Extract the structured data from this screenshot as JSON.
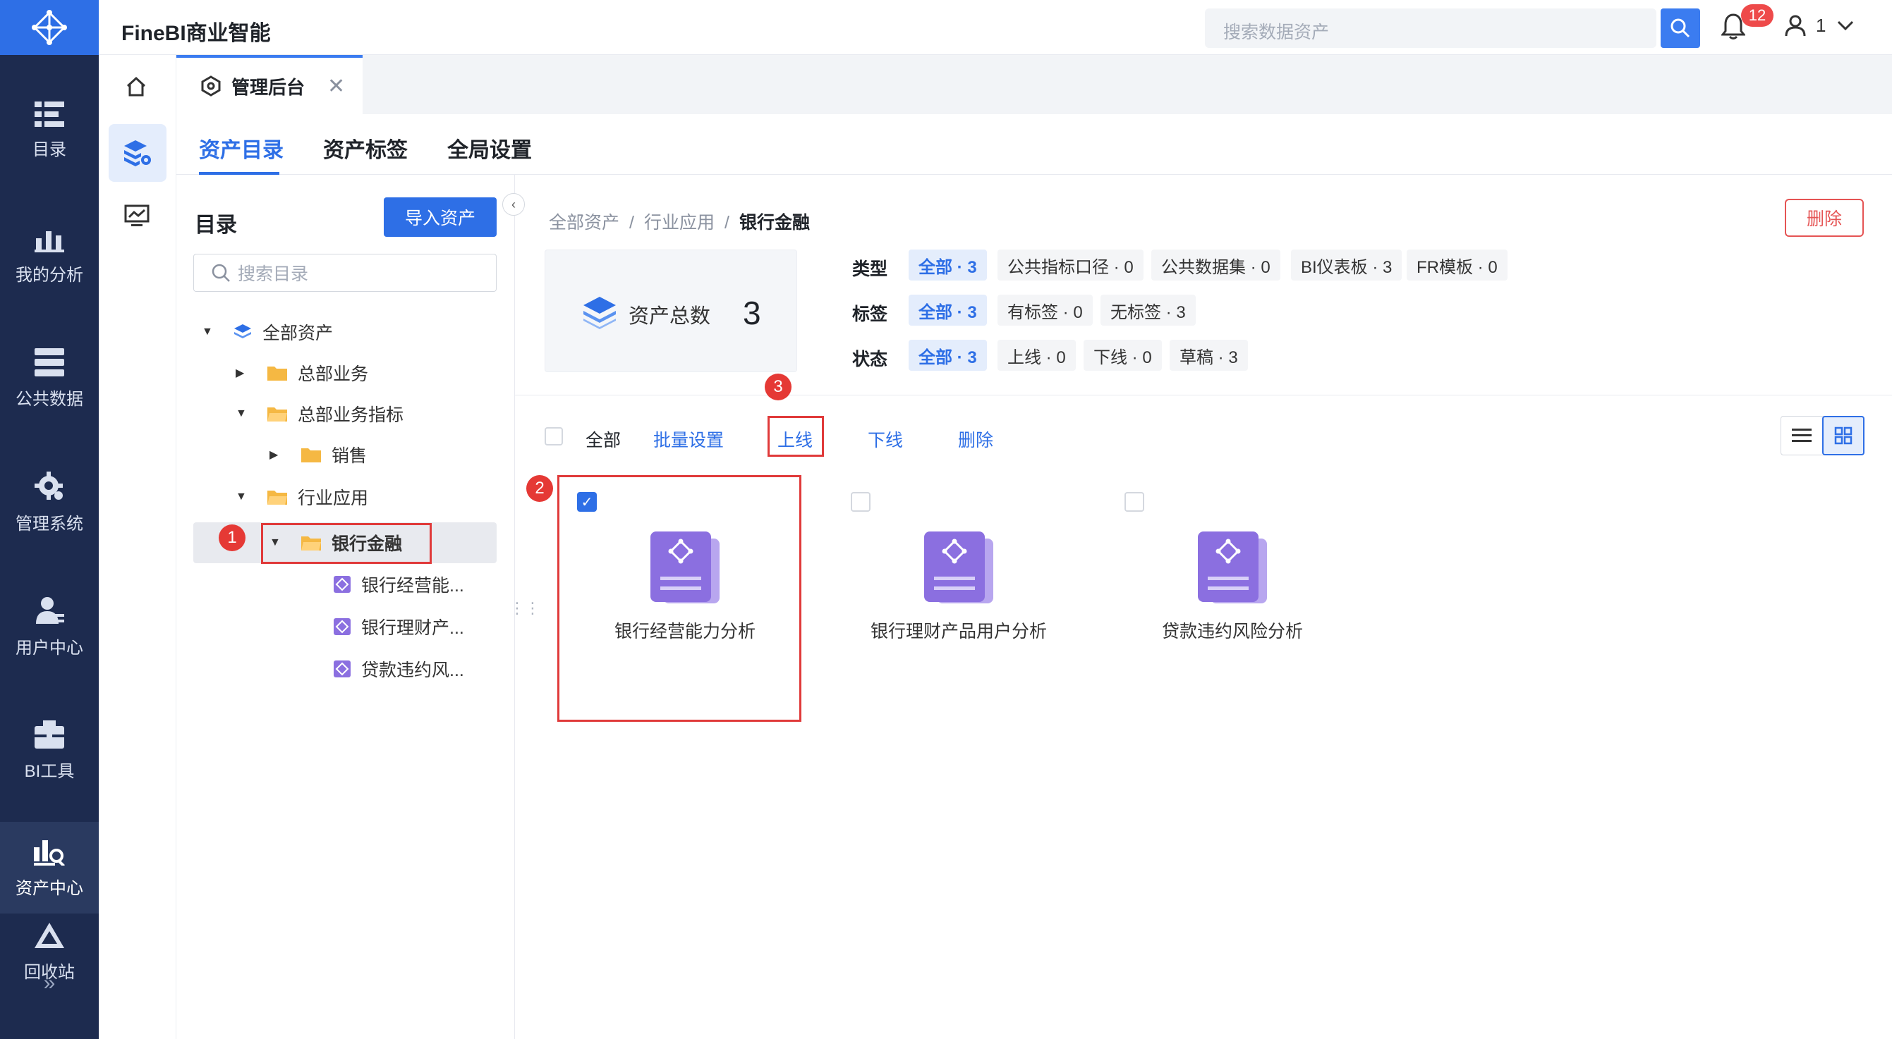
{
  "app": {
    "title": "FineBI商业智能"
  },
  "topbar": {
    "search_placeholder": "搜索数据资产",
    "notification_count": "12",
    "user_name": "1"
  },
  "nav": {
    "items": [
      {
        "label": "目录"
      },
      {
        "label": "我的分析"
      },
      {
        "label": "公共数据"
      },
      {
        "label": "管理系统"
      },
      {
        "label": "用户中心"
      },
      {
        "label": "BI工具"
      },
      {
        "label": "资产中心"
      },
      {
        "label": "回收站"
      }
    ],
    "expand": "»"
  },
  "tabs": {
    "active_tab": "管理后台"
  },
  "subtabs": [
    {
      "label": "资产目录"
    },
    {
      "label": "资产标签"
    },
    {
      "label": "全局设置"
    }
  ],
  "tree": {
    "title": "目录",
    "import_label": "导入资产",
    "search_placeholder": "搜索目录",
    "nodes": [
      {
        "label": "全部资产"
      },
      {
        "label": "总部业务"
      },
      {
        "label": "总部业务指标"
      },
      {
        "label": "销售"
      },
      {
        "label": "行业应用"
      },
      {
        "label": "银行金融"
      },
      {
        "label": "银行经营能..."
      },
      {
        "label": "银行理财产..."
      },
      {
        "label": "贷款违约风..."
      }
    ]
  },
  "breadcrumb": {
    "items": [
      "全部资产",
      "行业应用",
      "银行金融"
    ],
    "separator": "/"
  },
  "delete_label": "删除",
  "summary": {
    "label": "资产总数",
    "count": "3"
  },
  "filters": {
    "type": {
      "label": "类型",
      "chips": [
        "全部 · 3",
        "公共指标口径 · 0",
        "公共数据集 · 0",
        "BI仪表板 · 3",
        "FR模板 · 0"
      ]
    },
    "tag": {
      "label": "标签",
      "chips": [
        "全部 · 3",
        "有标签 · 0",
        "无标签 · 3"
      ]
    },
    "status": {
      "label": "状态",
      "chips": [
        "全部 · 3",
        "上线 · 0",
        "下线 · 0",
        "草稿 · 3"
      ]
    }
  },
  "toolbar": {
    "all": "全部",
    "batch": "批量设置",
    "online": "上线",
    "offline": "下线",
    "delete": "删除"
  },
  "cards": [
    {
      "name": "银行经营能力分析",
      "checked": true
    },
    {
      "name": "银行理财产品用户分析",
      "checked": false
    },
    {
      "name": "贷款违约风险分析",
      "checked": false
    }
  ],
  "annotations": [
    "1",
    "2",
    "3"
  ],
  "colors": {
    "primary": "#2e6fe6",
    "nav_bg": "#1d2b4f",
    "highlight": "#e03a3a",
    "asset_icon": "#8b6fe0"
  }
}
